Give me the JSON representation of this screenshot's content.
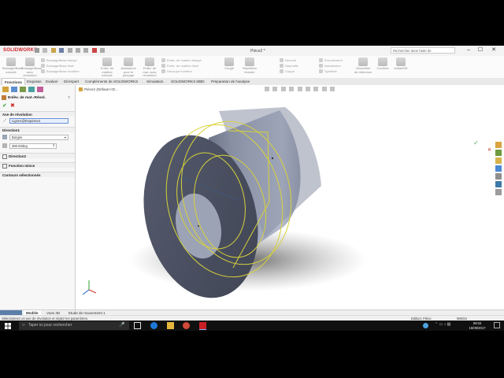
{
  "app": {
    "logo": "SOLIDWORKS",
    "document_title": "Pièce2 *",
    "help_search_placeholder": "Rechercher dans l'aide de SOLIDWORKS"
  },
  "ribbon": {
    "big_buttons": [
      {
        "label": "Bossage/Base extrudé"
      },
      {
        "label": "Bossage/Base avec révolution"
      },
      {
        "label": "Enlèv. de matière extrudé"
      },
      {
        "label": "Assistance pour le perçage"
      },
      {
        "label": "Enlèv. de mat. avec révolution"
      },
      {
        "label": "Congé"
      },
      {
        "label": "Répétition linéaire"
      },
      {
        "label": "Géométrie de référence"
      },
      {
        "label": "Courbes"
      },
      {
        "label": "Instant3D"
      }
    ],
    "small_col1": [
      "Bossage/Base balayé",
      "Bossage/Base lissé",
      "Bossage/Base frontière"
    ],
    "small_col2": [
      "Enlèv. de matière balayé",
      "Enlèv. de matière lissé",
      "Découpe frontière"
    ],
    "small_col3": [
      "Nervure",
      "Dépouille",
      "Coque"
    ],
    "small_col4": [
      "Enroulement",
      "Intersection",
      "Symétrie"
    ]
  },
  "command_tabs": [
    "Fonctions",
    "Esquisse",
    "Evaluer",
    "DimXpert",
    "Compléments de SOLIDWORKS",
    "Simulation",
    "SOLIDWORKS MBD",
    "Préparation de l'analyse"
  ],
  "panel": {
    "title": "Enlèv. de mat.-Révol.",
    "axis_section": "Axe de révolution",
    "axis_value": "Ligne4@Esquisse4",
    "direction1_section": "Direction1",
    "end_condition": "Borgne",
    "angle_value": "360.00deg",
    "direction2_section": "Direction2",
    "thin_feature_section": "Fonction mince",
    "selected_contours_section": "Contours sélectionnés"
  },
  "viewport": {
    "tree_label": "Pièce2  (Défaut<<D..."
  },
  "bottom_tabs": [
    "Modèle",
    "Vues 3D",
    "Etude de mouvement 1"
  ],
  "status": {
    "message": "Sélectionnez un axe de révolution et réglez les paramètres.",
    "mode": "Edition: Pièce",
    "units": "MMGS"
  },
  "taskbar": {
    "search_placeholder": "Taper ici pour rechercher",
    "time": "09:03",
    "date": "15/09/2017"
  },
  "colors": {
    "accent": "#d21f26",
    "part_body": "#8a91a6",
    "selection_yellow": "#d8d23a"
  }
}
